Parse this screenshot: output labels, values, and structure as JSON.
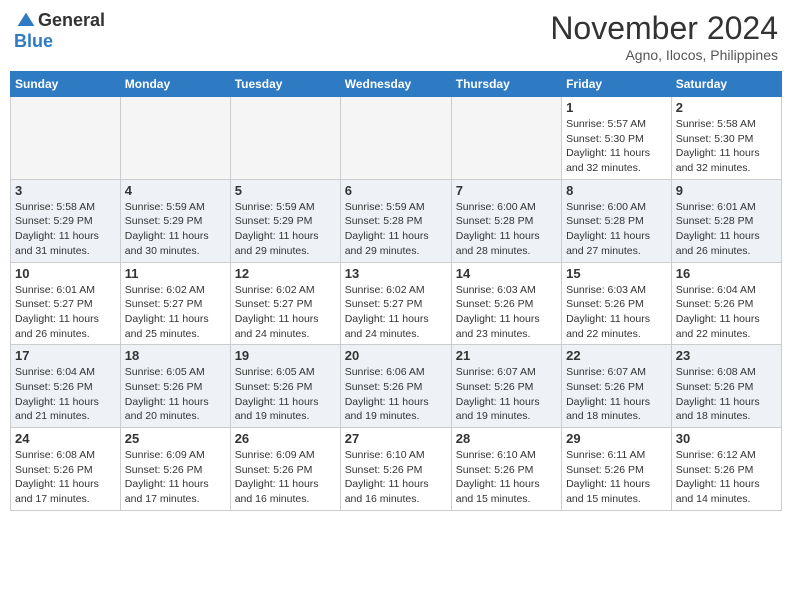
{
  "logo": {
    "general": "General",
    "blue": "Blue"
  },
  "title": {
    "month_year": "November 2024",
    "location": "Agno, Ilocos, Philippines"
  },
  "days_of_week": [
    "Sunday",
    "Monday",
    "Tuesday",
    "Wednesday",
    "Thursday",
    "Friday",
    "Saturday"
  ],
  "weeks": [
    {
      "days": [
        {
          "num": "",
          "empty": true
        },
        {
          "num": "",
          "empty": true
        },
        {
          "num": "",
          "empty": true
        },
        {
          "num": "",
          "empty": true
        },
        {
          "num": "",
          "empty": true
        },
        {
          "num": "1",
          "sunrise": "Sunrise: 5:57 AM",
          "sunset": "Sunset: 5:30 PM",
          "daylight": "Daylight: 11 hours and 32 minutes."
        },
        {
          "num": "2",
          "sunrise": "Sunrise: 5:58 AM",
          "sunset": "Sunset: 5:30 PM",
          "daylight": "Daylight: 11 hours and 32 minutes."
        }
      ]
    },
    {
      "days": [
        {
          "num": "3",
          "sunrise": "Sunrise: 5:58 AM",
          "sunset": "Sunset: 5:29 PM",
          "daylight": "Daylight: 11 hours and 31 minutes."
        },
        {
          "num": "4",
          "sunrise": "Sunrise: 5:59 AM",
          "sunset": "Sunset: 5:29 PM",
          "daylight": "Daylight: 11 hours and 30 minutes."
        },
        {
          "num": "5",
          "sunrise": "Sunrise: 5:59 AM",
          "sunset": "Sunset: 5:29 PM",
          "daylight": "Daylight: 11 hours and 29 minutes."
        },
        {
          "num": "6",
          "sunrise": "Sunrise: 5:59 AM",
          "sunset": "Sunset: 5:28 PM",
          "daylight": "Daylight: 11 hours and 29 minutes."
        },
        {
          "num": "7",
          "sunrise": "Sunrise: 6:00 AM",
          "sunset": "Sunset: 5:28 PM",
          "daylight": "Daylight: 11 hours and 28 minutes."
        },
        {
          "num": "8",
          "sunrise": "Sunrise: 6:00 AM",
          "sunset": "Sunset: 5:28 PM",
          "daylight": "Daylight: 11 hours and 27 minutes."
        },
        {
          "num": "9",
          "sunrise": "Sunrise: 6:01 AM",
          "sunset": "Sunset: 5:28 PM",
          "daylight": "Daylight: 11 hours and 26 minutes."
        }
      ]
    },
    {
      "days": [
        {
          "num": "10",
          "sunrise": "Sunrise: 6:01 AM",
          "sunset": "Sunset: 5:27 PM",
          "daylight": "Daylight: 11 hours and 26 minutes."
        },
        {
          "num": "11",
          "sunrise": "Sunrise: 6:02 AM",
          "sunset": "Sunset: 5:27 PM",
          "daylight": "Daylight: 11 hours and 25 minutes."
        },
        {
          "num": "12",
          "sunrise": "Sunrise: 6:02 AM",
          "sunset": "Sunset: 5:27 PM",
          "daylight": "Daylight: 11 hours and 24 minutes."
        },
        {
          "num": "13",
          "sunrise": "Sunrise: 6:02 AM",
          "sunset": "Sunset: 5:27 PM",
          "daylight": "Daylight: 11 hours and 24 minutes."
        },
        {
          "num": "14",
          "sunrise": "Sunrise: 6:03 AM",
          "sunset": "Sunset: 5:26 PM",
          "daylight": "Daylight: 11 hours and 23 minutes."
        },
        {
          "num": "15",
          "sunrise": "Sunrise: 6:03 AM",
          "sunset": "Sunset: 5:26 PM",
          "daylight": "Daylight: 11 hours and 22 minutes."
        },
        {
          "num": "16",
          "sunrise": "Sunrise: 6:04 AM",
          "sunset": "Sunset: 5:26 PM",
          "daylight": "Daylight: 11 hours and 22 minutes."
        }
      ]
    },
    {
      "days": [
        {
          "num": "17",
          "sunrise": "Sunrise: 6:04 AM",
          "sunset": "Sunset: 5:26 PM",
          "daylight": "Daylight: 11 hours and 21 minutes."
        },
        {
          "num": "18",
          "sunrise": "Sunrise: 6:05 AM",
          "sunset": "Sunset: 5:26 PM",
          "daylight": "Daylight: 11 hours and 20 minutes."
        },
        {
          "num": "19",
          "sunrise": "Sunrise: 6:05 AM",
          "sunset": "Sunset: 5:26 PM",
          "daylight": "Daylight: 11 hours and 19 minutes."
        },
        {
          "num": "20",
          "sunrise": "Sunrise: 6:06 AM",
          "sunset": "Sunset: 5:26 PM",
          "daylight": "Daylight: 11 hours and 19 minutes."
        },
        {
          "num": "21",
          "sunrise": "Sunrise: 6:07 AM",
          "sunset": "Sunset: 5:26 PM",
          "daylight": "Daylight: 11 hours and 19 minutes."
        },
        {
          "num": "22",
          "sunrise": "Sunrise: 6:07 AM",
          "sunset": "Sunset: 5:26 PM",
          "daylight": "Daylight: 11 hours and 18 minutes."
        },
        {
          "num": "23",
          "sunrise": "Sunrise: 6:08 AM",
          "sunset": "Sunset: 5:26 PM",
          "daylight": "Daylight: 11 hours and 18 minutes."
        }
      ]
    },
    {
      "days": [
        {
          "num": "24",
          "sunrise": "Sunrise: 6:08 AM",
          "sunset": "Sunset: 5:26 PM",
          "daylight": "Daylight: 11 hours and 17 minutes."
        },
        {
          "num": "25",
          "sunrise": "Sunrise: 6:09 AM",
          "sunset": "Sunset: 5:26 PM",
          "daylight": "Daylight: 11 hours and 17 minutes."
        },
        {
          "num": "26",
          "sunrise": "Sunrise: 6:09 AM",
          "sunset": "Sunset: 5:26 PM",
          "daylight": "Daylight: 11 hours and 16 minutes."
        },
        {
          "num": "27",
          "sunrise": "Sunrise: 6:10 AM",
          "sunset": "Sunset: 5:26 PM",
          "daylight": "Daylight: 11 hours and 16 minutes."
        },
        {
          "num": "28",
          "sunrise": "Sunrise: 6:10 AM",
          "sunset": "Sunset: 5:26 PM",
          "daylight": "Daylight: 11 hours and 15 minutes."
        },
        {
          "num": "29",
          "sunrise": "Sunrise: 6:11 AM",
          "sunset": "Sunset: 5:26 PM",
          "daylight": "Daylight: 11 hours and 15 minutes."
        },
        {
          "num": "30",
          "sunrise": "Sunrise: 6:12 AM",
          "sunset": "Sunset: 5:26 PM",
          "daylight": "Daylight: 11 hours and 14 minutes."
        }
      ]
    }
  ]
}
